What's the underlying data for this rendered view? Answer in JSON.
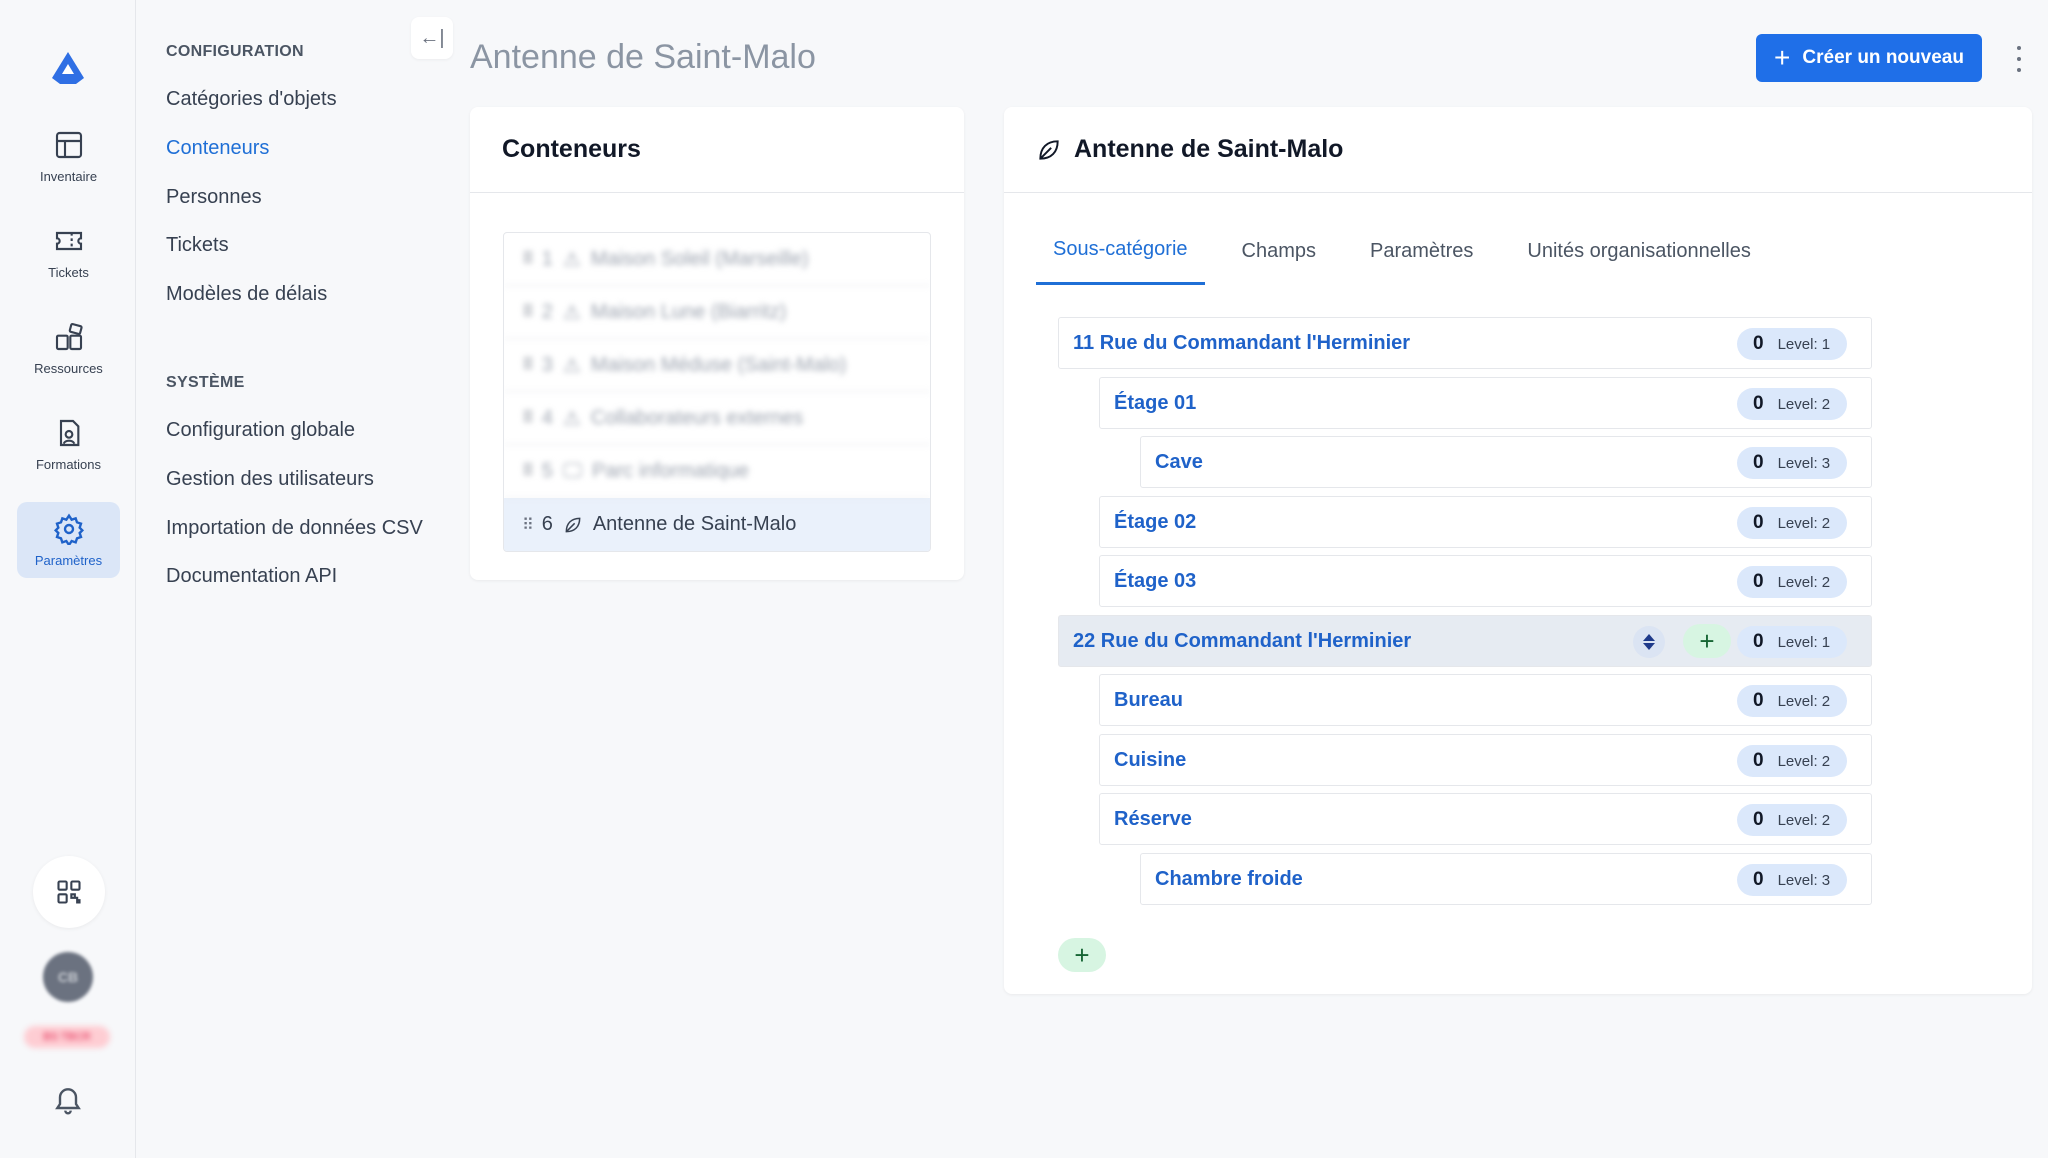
{
  "rail": {
    "items": [
      {
        "label": "Inventaire",
        "icon": "grid-icon"
      },
      {
        "label": "Tickets",
        "icon": "ticket-icon"
      },
      {
        "label": "Ressources",
        "icon": "resources-icon"
      },
      {
        "label": "Formations",
        "icon": "document-person-icon"
      },
      {
        "label": "Paramètres",
        "icon": "gear-icon",
        "active": true
      }
    ],
    "avatar_initials": "CB",
    "badge": "BS TBCR"
  },
  "nav": {
    "section1_title": "CONFIGURATION",
    "section1_items": [
      "Catégories d'objets",
      "Conteneurs",
      "Personnes",
      "Tickets",
      "Modèles de délais"
    ],
    "section2_title": "SYSTÈME",
    "section2_items": [
      "Configuration globale",
      "Gestion des utilisateurs",
      "Importation de données CSV",
      "Documentation API"
    ],
    "collapse_icon": "←|"
  },
  "header": {
    "title": "Antenne de Saint-Malo",
    "create_label": "Créer un nouveau",
    "create_icon": "+"
  },
  "containers": {
    "title": "Conteneurs",
    "items": [
      {
        "num": "1",
        "name": "Maison Soleil (Marseille)"
      },
      {
        "num": "2",
        "name": "Maison Lune (Biarritz)"
      },
      {
        "num": "3",
        "name": "Maison Méduse (Saint-Malo)"
      },
      {
        "num": "4",
        "name": "Collaborateurs externes"
      },
      {
        "num": "5",
        "name": "Parc informatique"
      },
      {
        "num": "6",
        "name": "Antenne de Saint-Malo"
      }
    ]
  },
  "detail": {
    "title": "Antenne de Saint-Malo",
    "tabs": [
      "Sous-catégorie",
      "Champs",
      "Paramètres",
      "Unités organisationnelles"
    ],
    "tree": [
      {
        "label": "11 Rue du Commandant l'Herminier",
        "count": "0",
        "level": "Level: 1"
      },
      {
        "label": "Étage 01",
        "count": "0",
        "level": "Level: 2"
      },
      {
        "label": "Cave",
        "count": "0",
        "level": "Level: 3"
      },
      {
        "label": "Étage 02",
        "count": "0",
        "level": "Level: 2"
      },
      {
        "label": "Étage 03",
        "count": "0",
        "level": "Level: 2"
      },
      {
        "label": "22 Rue du Commandant l'Herminier",
        "count": "0",
        "level": "Level: 1"
      },
      {
        "label": "Bureau",
        "count": "0",
        "level": "Level: 2"
      },
      {
        "label": "Cuisine",
        "count": "0",
        "level": "Level: 2"
      },
      {
        "label": "Réserve",
        "count": "0",
        "level": "Level: 2"
      },
      {
        "label": "Chambre froide",
        "count": "0",
        "level": "Level: 3"
      }
    ],
    "add_icon": "+"
  },
  "colors": {
    "accent": "#1f6fe8",
    "link": "#1f62c9",
    "active_bg": "#dbe6f7"
  }
}
